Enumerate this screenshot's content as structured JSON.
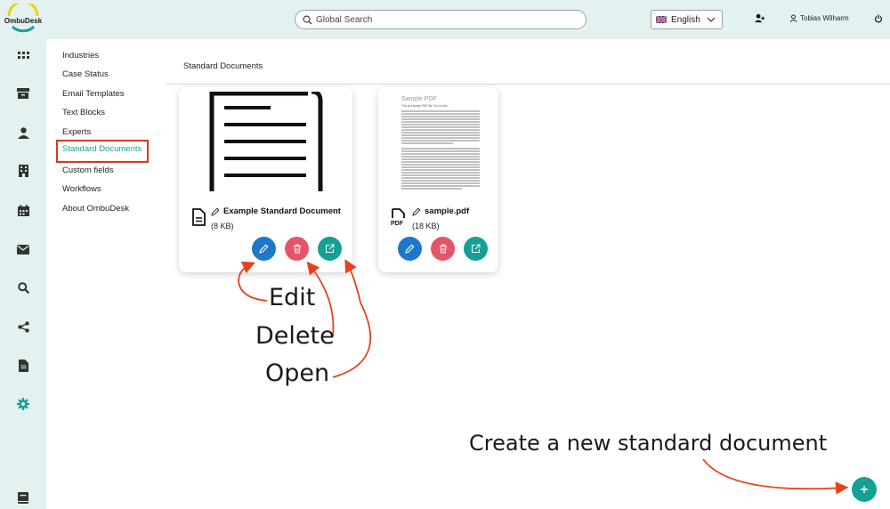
{
  "app": {
    "logo_text": "OmbuDesk"
  },
  "header": {
    "search_placeholder": "Global Search",
    "language": "English",
    "user_name": "Tobias Wilharm"
  },
  "settings_nav": {
    "items": [
      {
        "label": "Industries"
      },
      {
        "label": "Case Status"
      },
      {
        "label": "Email Templates"
      },
      {
        "label": "Text Blocks"
      },
      {
        "label": "Experts"
      },
      {
        "label": "Standard Documents",
        "active": true
      },
      {
        "label": "Custom fields"
      },
      {
        "label": "Workflows"
      },
      {
        "label": "About OmbuDesk"
      }
    ]
  },
  "main": {
    "title": "Standard Documents",
    "documents": [
      {
        "name": "Example Standard Document",
        "size": "(8 KB)",
        "type_icon": "document-icon"
      },
      {
        "name": "sample.pdf",
        "size": "(18 KB)",
        "type_icon": "pdf-icon",
        "preview_title": "Sample PDF",
        "preview_subtitle": "This is a simple PDF file. Fun fun fun."
      }
    ]
  },
  "annotations": {
    "edit": "Edit",
    "delete": "Delete",
    "open": "Open",
    "create": "Create a new standard document"
  },
  "colors": {
    "accent": "#14a093",
    "edit": "#1f77c9",
    "delete": "#e5556a",
    "highlight_box": "#d43a1e",
    "arrow": "#e8401c"
  }
}
